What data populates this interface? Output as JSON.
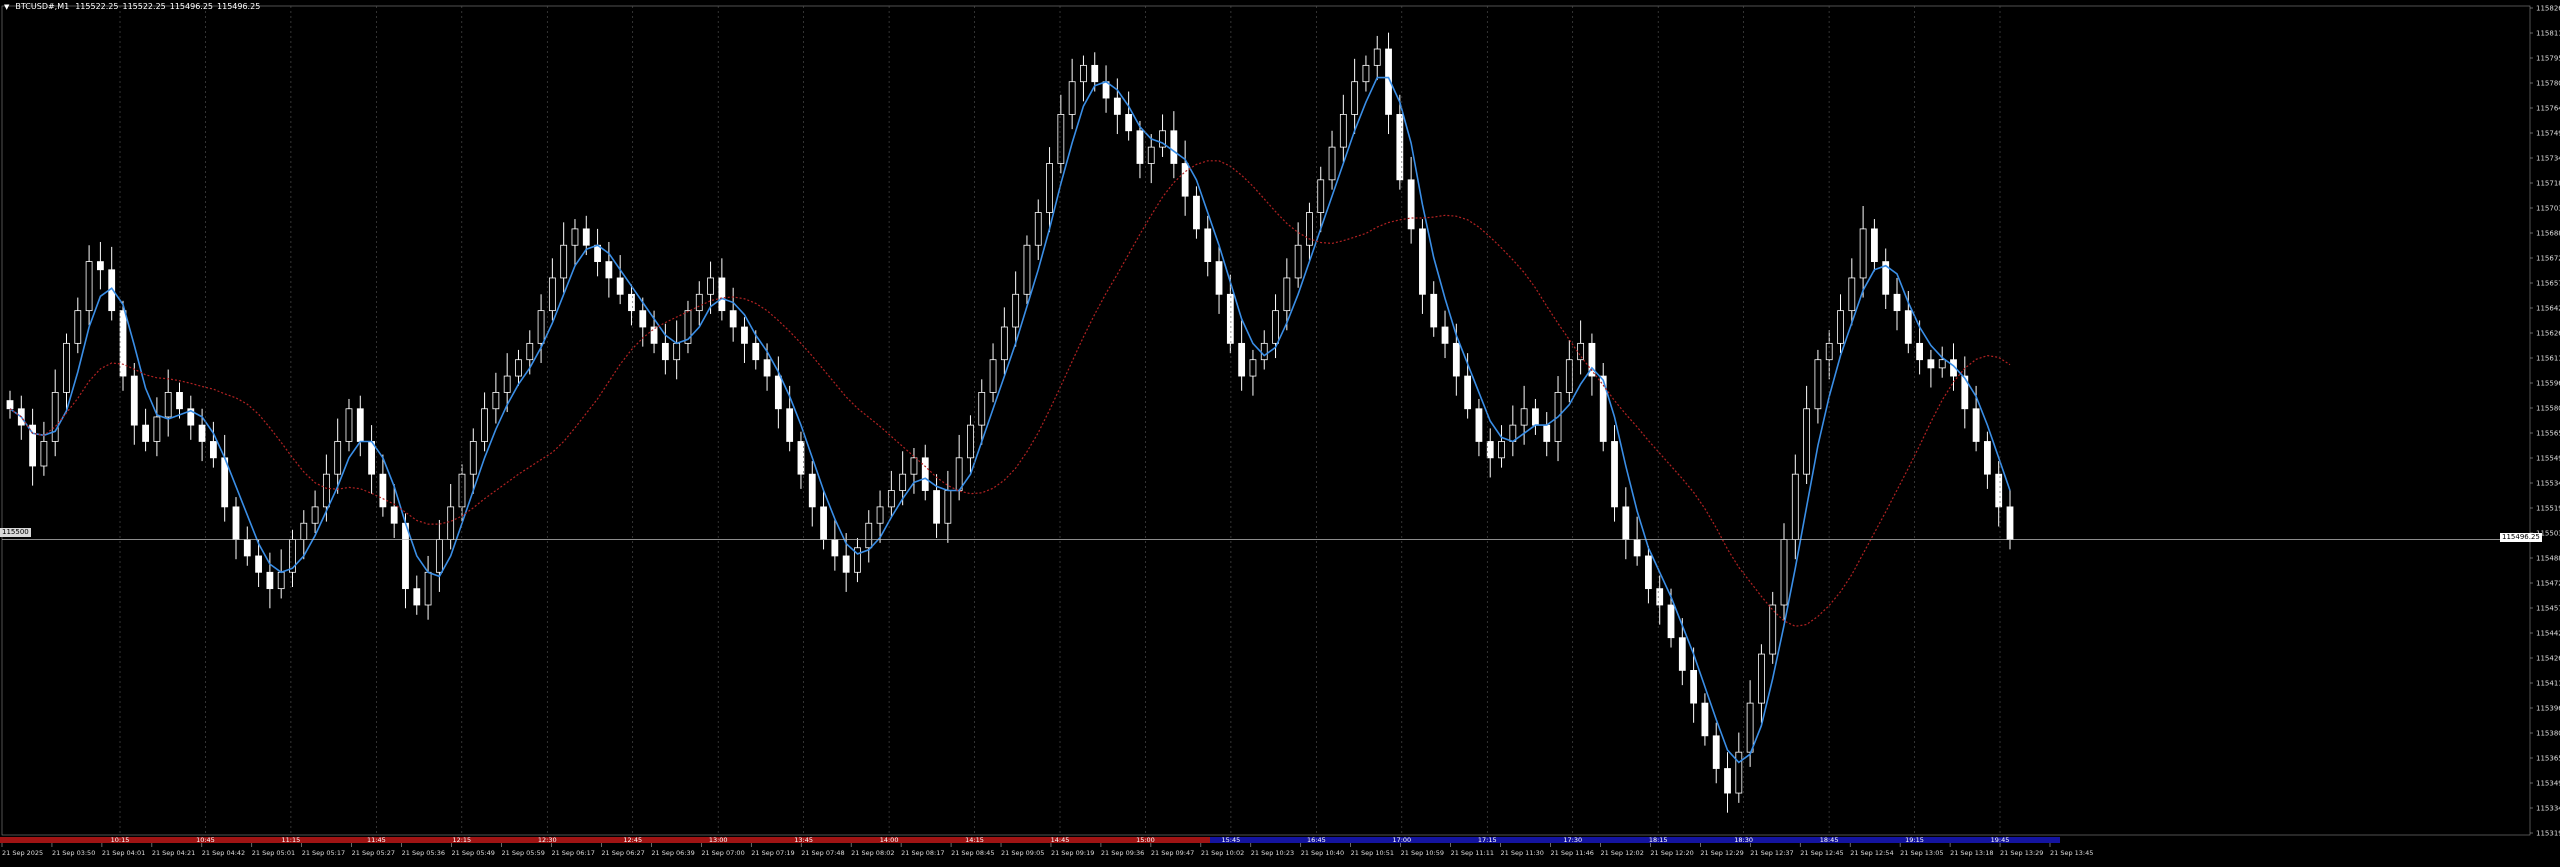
{
  "header": {
    "symbol": "BTCUSD#,M1",
    "open": "115522.25",
    "high": "115522.25",
    "low": "115496.25",
    "close": "115496.25"
  },
  "current_price": {
    "left_label": "115500",
    "right_label": "115496.25"
  },
  "price_axis": [
    "115826.30",
    "115811.20",
    "115795.90",
    "115780.60",
    "115764.85",
    "115749.15",
    "115734.25",
    "115718.90",
    "115703.65",
    "115688.35",
    "115672.60",
    "115657.30",
    "115642.00",
    "115626.70",
    "115611.45",
    "115596.10",
    "115580.35",
    "115565.05",
    "115549.75",
    "115534.45",
    "115519.15",
    "115503.85",
    "115488.55",
    "115472.80",
    "115457.50",
    "115442.20",
    "115426.90",
    "115411.60",
    "115396.30",
    "115380.55",
    "115365.25",
    "115349.95",
    "115334.65",
    "115319.35"
  ],
  "session_labels": [
    "10:15",
    "10:45",
    "11:15",
    "11:45",
    "12:15",
    "12:30",
    "12:45",
    "13:00",
    "13:45",
    "14:00",
    "14:15",
    "14:45",
    "15:00",
    "15:45",
    "16:45",
    "17:00",
    "17:15",
    "17:30",
    "18:15",
    "18:30",
    "18:45",
    "19:15",
    "19:45"
  ],
  "time_axis": [
    "21 Sep 2025",
    "21 Sep 03:50",
    "21 Sep 04:01",
    "21 Sep 04:21",
    "21 Sep 04:42",
    "21 Sep 05:01",
    "21 Sep 05:17",
    "21 Sep 05:27",
    "21 Sep 05:36",
    "21 Sep 05:49",
    "21 Sep 05:59",
    "21 Sep 06:17",
    "21 Sep 06:27",
    "21 Sep 06:39",
    "21 Sep 07:00",
    "21 Sep 07:19",
    "21 Sep 07:48",
    "21 Sep 08:02",
    "21 Sep 08:17",
    "21 Sep 08:45",
    "21 Sep 09:05",
    "21 Sep 09:19",
    "21 Sep 09:36",
    "21 Sep 09:47",
    "21 Sep 10:02",
    "21 Sep 10:23",
    "21 Sep 10:40",
    "21 Sep 10:51",
    "21 Sep 10:59",
    "21 Sep 11:11",
    "21 Sep 11:30",
    "21 Sep 11:46",
    "21 Sep 12:02",
    "21 Sep 12:20",
    "21 Sep 12:29",
    "21 Sep 12:37",
    "21 Sep 12:45",
    "21 Sep 12:54",
    "21 Sep 13:05",
    "21 Sep 13:18",
    "21 Sep 13:29",
    "21 Sep 13:45"
  ],
  "colors": {
    "background": "#000000",
    "candle": "#ffffff",
    "fast_ma": "#3a8ee6",
    "slow_ma": "#b22222",
    "red_bar": "#a01414",
    "blue_bar": "#1414a0",
    "grid": "#555555"
  },
  "chart_data": {
    "type": "candlestick",
    "symbol": "BTCUSD#",
    "timeframe": "M1",
    "ylim": [
      115319.35,
      115826.3
    ],
    "closes": [
      115580,
      115570,
      115545,
      115560,
      115590,
      115620,
      115640,
      115670,
      115665,
      115640,
      115600,
      115570,
      115560,
      115575,
      115590,
      115580,
      115570,
      115560,
      115550,
      115520,
      115500,
      115490,
      115480,
      115470,
      115480,
      115500,
      115510,
      115520,
      115540,
      115560,
      115580,
      115560,
      115540,
      115520,
      115510,
      115470,
      115460,
      115480,
      115500,
      115520,
      115540,
      115560,
      115580,
      115590,
      115600,
      115610,
      115620,
      115640,
      115660,
      115680,
      115690,
      115680,
      115670,
      115660,
      115650,
      115640,
      115630,
      115620,
      115610,
      115620,
      115640,
      115650,
      115660,
      115640,
      115630,
      115620,
      115610,
      115600,
      115580,
      115560,
      115540,
      115520,
      115500,
      115490,
      115480,
      115495,
      115510,
      115520,
      115530,
      115540,
      115550,
      115530,
      115510,
      115530,
      115550,
      115570,
      115590,
      115610,
      115630,
      115650,
      115680,
      115700,
      115730,
      115760,
      115780,
      115790,
      115780,
      115770,
      115760,
      115750,
      115730,
      115740,
      115750,
      115730,
      115710,
      115690,
      115670,
      115650,
      115620,
      115600,
      115610,
      115620,
      115640,
      115660,
      115680,
      115700,
      115720,
      115740,
      115760,
      115780,
      115790,
      115800,
      115760,
      115720,
      115690,
      115650,
      115630,
      115620,
      115600,
      115580,
      115560,
      115550,
      115560,
      115570,
      115580,
      115570,
      115560,
      115590,
      115610,
      115620,
      115600,
      115560,
      115520,
      115500,
      115490,
      115470,
      115460,
      115440,
      115420,
      115400,
      115380,
      115360,
      115345,
      115370,
      115400,
      115430,
      115460,
      115500,
      115540,
      115580,
      115610,
      115620,
      115640,
      115660,
      115690,
      115670,
      115650,
      115640,
      115620,
      115610,
      115605,
      115610,
      115600,
      115580,
      115560,
      115540,
      115520,
      115500
    ]
  }
}
